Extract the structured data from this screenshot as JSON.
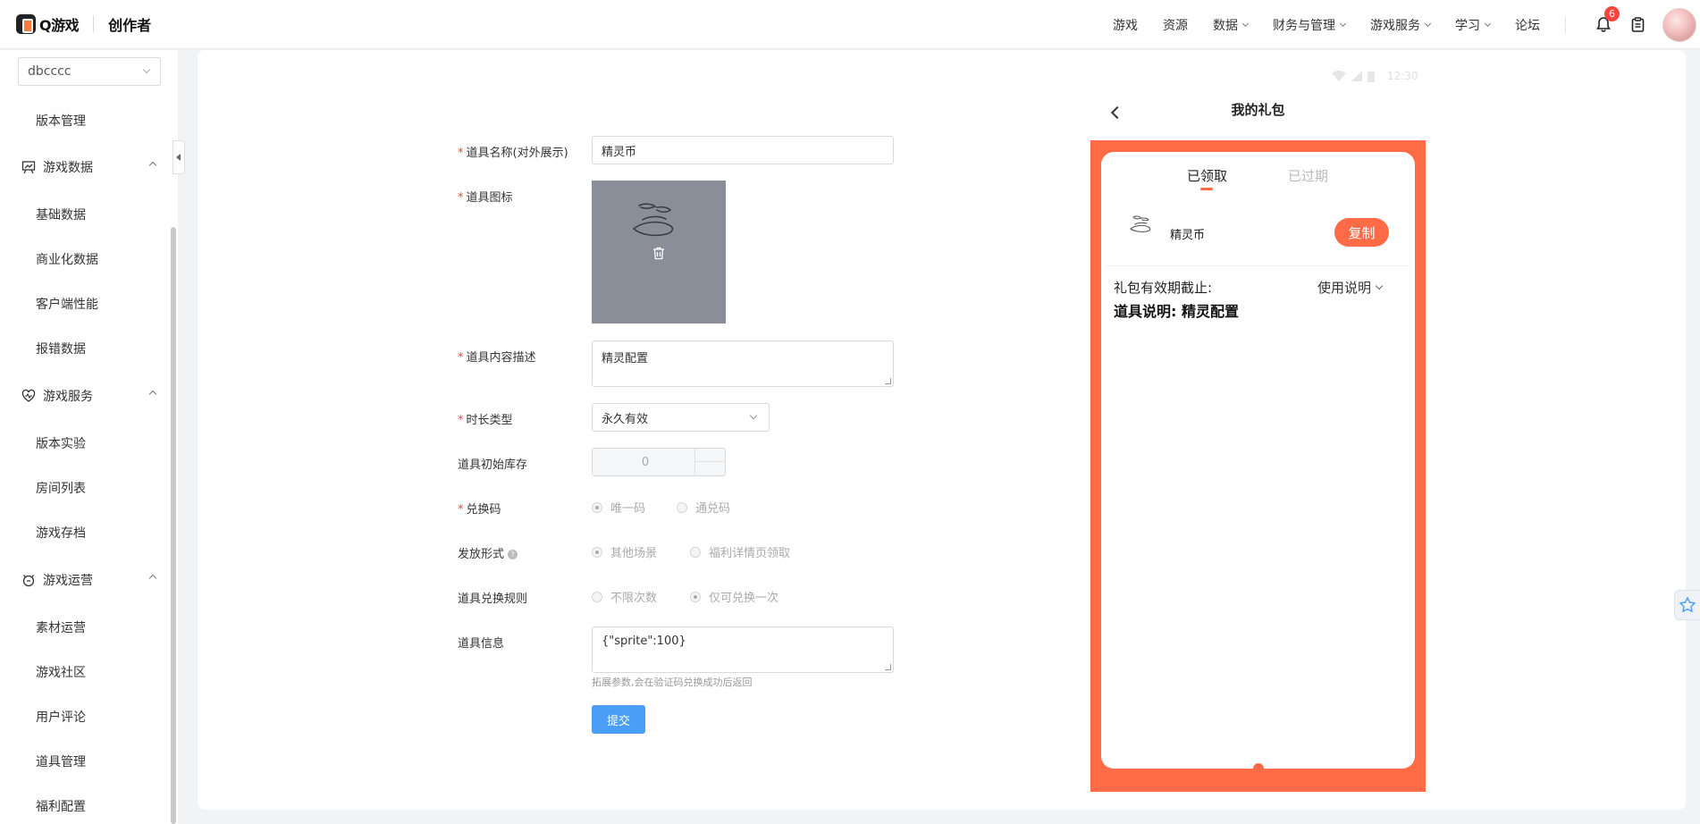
{
  "header": {
    "logo_text": "Q游戏",
    "app_title": "创作者",
    "nav": [
      {
        "label": "游戏",
        "dropdown": false
      },
      {
        "label": "资源",
        "dropdown": false
      },
      {
        "label": "数据",
        "dropdown": true
      },
      {
        "label": "财务与管理",
        "dropdown": true
      },
      {
        "label": "游戏服务",
        "dropdown": true
      },
      {
        "label": "学习",
        "dropdown": true
      },
      {
        "label": "论坛",
        "dropdown": false
      }
    ],
    "notification_count": "6"
  },
  "sidebar": {
    "project_select": "dbcccc",
    "items": {
      "version_management": "版本管理",
      "group_game_data": "游戏数据",
      "basic_data": "基础数据",
      "commercial_data": "商业化数据",
      "client_performance": "客户端性能",
      "error_data": "报错数据",
      "group_game_service": "游戏服务",
      "version_experiment": "版本实验",
      "room_list": "房间列表",
      "game_archive": "游戏存档",
      "group_game_ops": "游戏运营",
      "material_ops": "素材运营",
      "game_community": "游戏社区",
      "user_reviews": "用户评论",
      "item_management": "道具管理",
      "welfare_config": "福利配置"
    }
  },
  "form": {
    "item_name_label": "道具名称(对外展示)",
    "item_name_value": "精灵币",
    "item_icon_label": "道具图标",
    "item_desc_label": "道具内容描述",
    "item_desc_value": "精灵配置",
    "duration_label": "时长类型",
    "duration_value": "永久有效",
    "initial_stock_label": "道具初始库存",
    "initial_stock_value": "0",
    "code_label": "兑换码",
    "code_options": [
      "唯一码",
      "通兑码"
    ],
    "code_selected": 0,
    "distribution_label": "发放形式",
    "distribution_options": [
      "其他场景",
      "福利详情页领取"
    ],
    "distribution_selected": 0,
    "exchange_rule_label": "道具兑换规则",
    "exchange_rule_options": [
      "不限次数",
      "仅可兑换一次"
    ],
    "exchange_rule_selected": 1,
    "item_info_label": "道具信息",
    "item_info_value": "{\"sprite\":100}",
    "item_info_hint": "拓展参数,会在验证码兑换成功后返回",
    "submit_label": "提交"
  },
  "preview": {
    "status_time": "12:30",
    "title": "我的礼包",
    "tab_claimed": "已领取",
    "tab_expired": "已过期",
    "gift_name": "精灵币",
    "copy_label": "复制",
    "valid_until_label": "礼包有效期截止:",
    "usage_label": "使用说明",
    "item_desc": "道具说明: 精灵配置",
    "accent_color": "#ff6b47"
  },
  "colors": {
    "primary": "#4a9ef6",
    "required": "#f5453d",
    "badge": "#f5453d"
  }
}
